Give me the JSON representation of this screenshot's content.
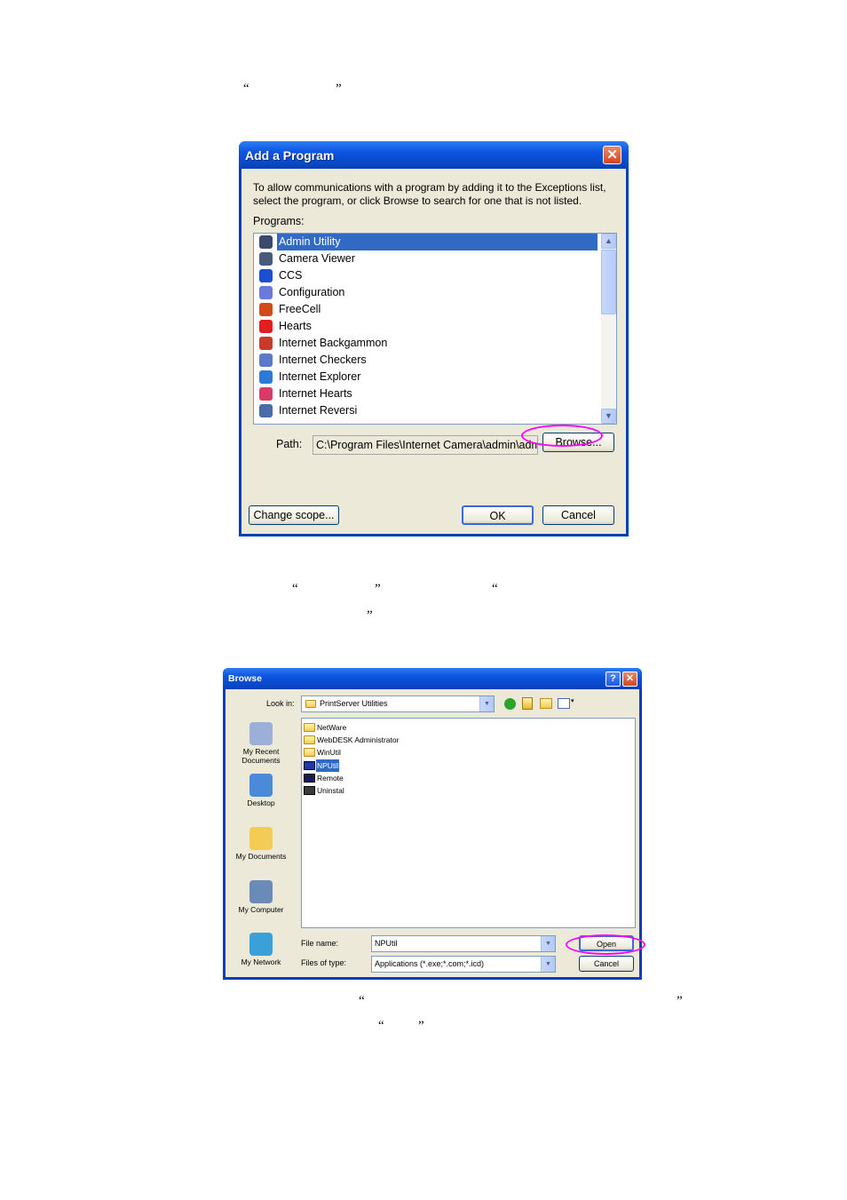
{
  "doc_quotes": {
    "q1_open": "“",
    "q1_close": "”",
    "q2_open": "“",
    "q2_close": "”",
    "q3_open": "“",
    "q3_close": "”",
    "q4_open": "“",
    "q4_close": "”",
    "q5_open": "“",
    "q5_close": "”"
  },
  "add_program": {
    "title": "Add a Program",
    "close_glyph": "✕",
    "description": "To allow communications with a program by adding it to the Exceptions list, select the program, or click Browse to search for one that is not listed.",
    "programs_label": "Programs:",
    "programs": [
      {
        "name": "Admin Utility",
        "selected": true,
        "icon": "admin-utility-icon",
        "color": "#3a4a6a"
      },
      {
        "name": "Camera Viewer",
        "selected": false,
        "icon": "camera-viewer-icon",
        "color": "#4a5a7a"
      },
      {
        "name": "CCS",
        "selected": false,
        "icon": "ccs-icon",
        "color": "#1a4fd0"
      },
      {
        "name": "Configuration",
        "selected": false,
        "icon": "configuration-icon",
        "color": "#6a7ad8"
      },
      {
        "name": "FreeCell",
        "selected": false,
        "icon": "freecell-icon",
        "color": "#d04a1a"
      },
      {
        "name": "Hearts",
        "selected": false,
        "icon": "hearts-icon",
        "color": "#e02020"
      },
      {
        "name": "Internet Backgammon",
        "selected": false,
        "icon": "backgammon-icon",
        "color": "#c83a2a"
      },
      {
        "name": "Internet Checkers",
        "selected": false,
        "icon": "checkers-icon",
        "color": "#5a7ac8"
      },
      {
        "name": "Internet Explorer",
        "selected": false,
        "icon": "internet-explorer-icon",
        "color": "#2a7ad8"
      },
      {
        "name": "Internet Hearts",
        "selected": false,
        "icon": "internet-hearts-icon",
        "color": "#d83a6a"
      },
      {
        "name": "Internet Reversi",
        "selected": false,
        "icon": "reversi-icon",
        "color": "#4a6aa8"
      }
    ],
    "path_label": "Path:",
    "path_value": "C:\\Program Files\\Internet Camera\\admin\\admi",
    "browse_button": "Browse...",
    "change_scope_button": "Change scope...",
    "ok_button": "OK",
    "cancel_button": "Cancel"
  },
  "browse": {
    "title": "Browse",
    "help_glyph": "?",
    "close_glyph": "✕",
    "look_in_label": "Look in:",
    "look_in_value": "PrintServer Utilities",
    "places": [
      {
        "label": "My Recent Documents",
        "icon": "recent-documents-icon"
      },
      {
        "label": "Desktop",
        "icon": "desktop-icon"
      },
      {
        "label": "My Documents",
        "icon": "my-documents-icon"
      },
      {
        "label": "My Computer",
        "icon": "my-computer-icon"
      },
      {
        "label": "My Network",
        "icon": "my-network-icon"
      }
    ],
    "files": [
      {
        "name": "NetWare",
        "type": "folder",
        "selected": false
      },
      {
        "name": "WebDESK Administrator",
        "type": "folder",
        "selected": false
      },
      {
        "name": "WinUtil",
        "type": "folder",
        "selected": false
      },
      {
        "name": "NPUtil",
        "type": "app",
        "selected": true
      },
      {
        "name": "Remote",
        "type": "app",
        "selected": false
      },
      {
        "name": "Uninstal",
        "type": "app",
        "selected": false
      }
    ],
    "file_name_label": "File name:",
    "file_name_value": "NPUtil",
    "files_of_type_label": "Files of type:",
    "files_of_type_value": "Applications (*.exe;*.com;*.icd)",
    "open_button": "Open",
    "cancel_button": "Cancel",
    "dropdown_glyph": "▼"
  },
  "colors": {
    "xp_blue": "#0a3fb8",
    "highlight": "#316ac5",
    "annotation": "#ff00ff",
    "dialog_bg": "#ece9d8"
  }
}
